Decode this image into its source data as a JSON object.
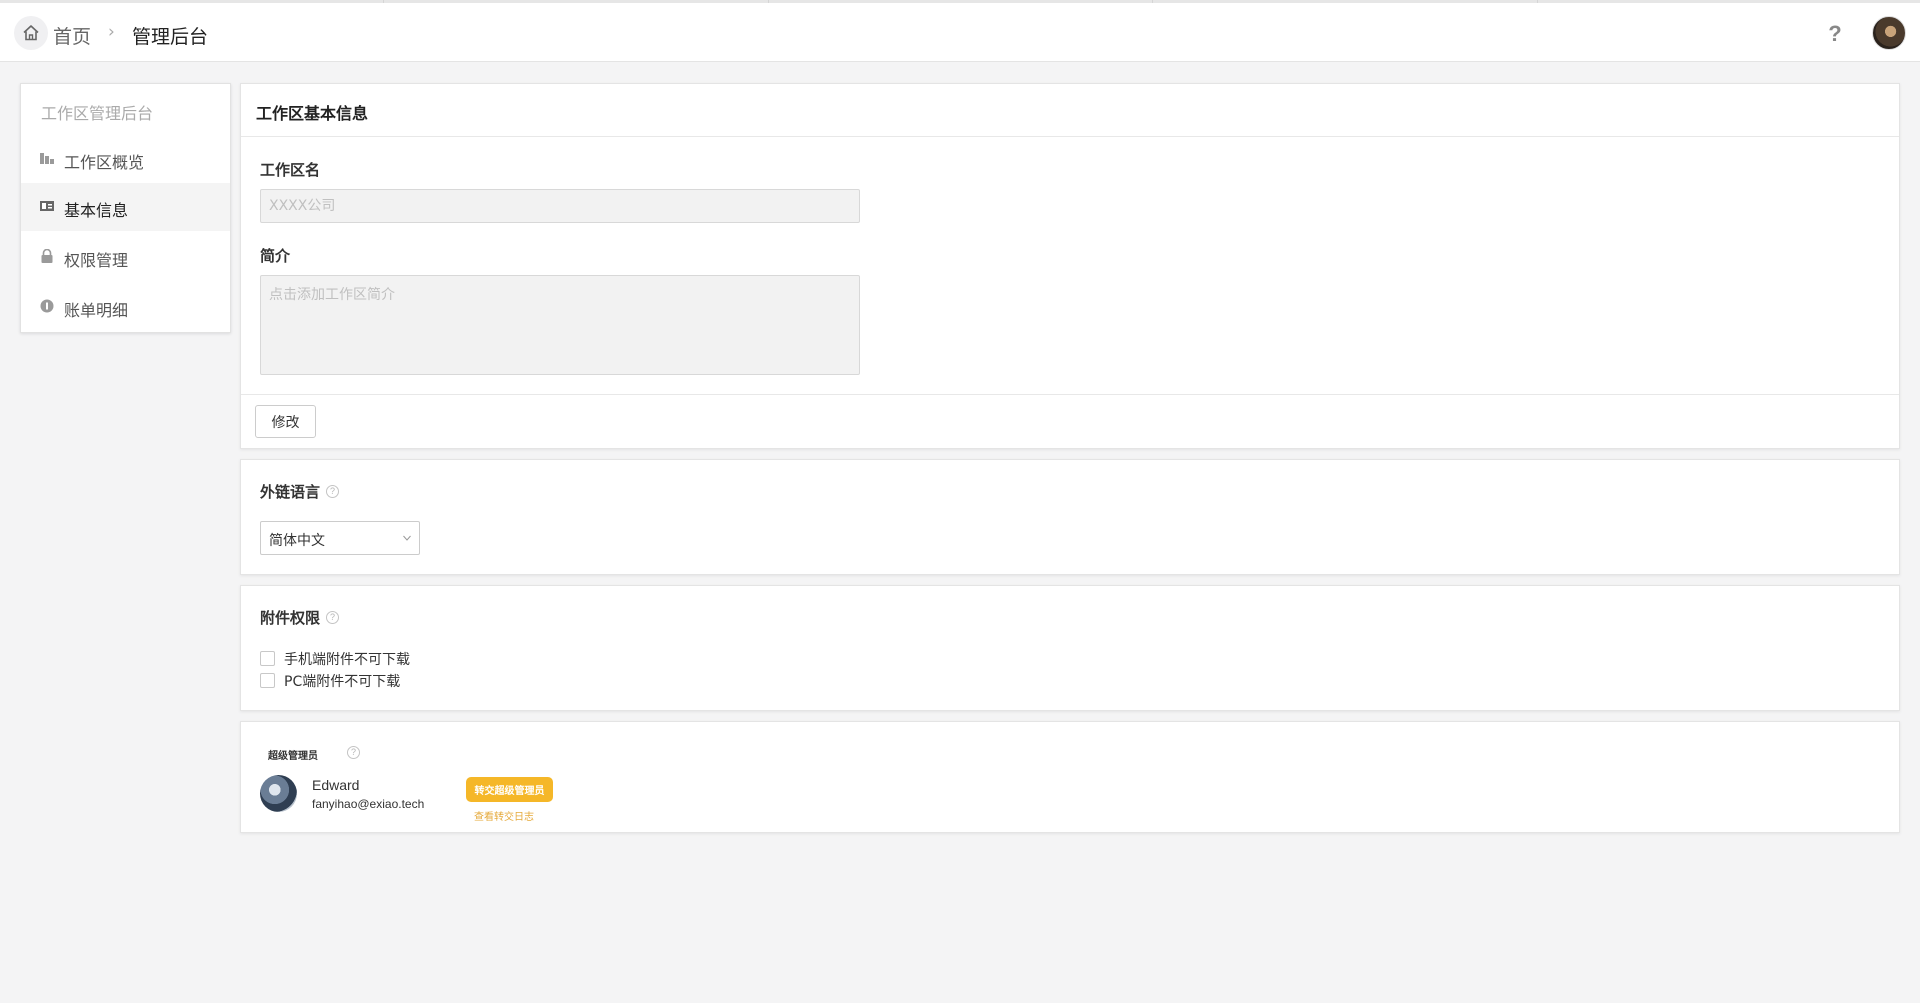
{
  "header": {
    "breadcrumb_home": "首页",
    "breadcrumb_separator": "›",
    "breadcrumb_current": "管理后台",
    "help_icon": "?"
  },
  "sidebar": {
    "title": "工作区管理后台",
    "items": [
      {
        "label": "工作区概览",
        "icon": "bar-chart-icon",
        "active": false
      },
      {
        "label": "基本信息",
        "icon": "id-card-icon",
        "active": true
      },
      {
        "label": "权限管理",
        "icon": "lock-icon",
        "active": false
      },
      {
        "label": "账单明细",
        "icon": "coin-icon",
        "active": false
      }
    ]
  },
  "basic_info": {
    "title": "工作区基本信息",
    "name_label": "工作区名",
    "name_placeholder": "XXXX公司",
    "intro_label": "简介",
    "intro_placeholder": "点击添加工作区简介",
    "modify_button": "修改"
  },
  "link_language": {
    "title": "外链语言",
    "help": "?",
    "selected": "简体中文"
  },
  "attachment_permission": {
    "title": "附件权限",
    "help": "?",
    "options": [
      {
        "label": "手机端附件不可下载",
        "checked": false
      },
      {
        "label": "PC端附件不可下载",
        "checked": false
      }
    ]
  },
  "super_admin": {
    "title": "超级管理员",
    "help": "?",
    "name": "Edward",
    "email": "fanyihao@exiao.tech",
    "transfer_button": "转交超级管理员",
    "transfer_log_link": "查看转交日志"
  },
  "colors": {
    "accent": "#f5b728",
    "background": "#f4f4f5"
  }
}
